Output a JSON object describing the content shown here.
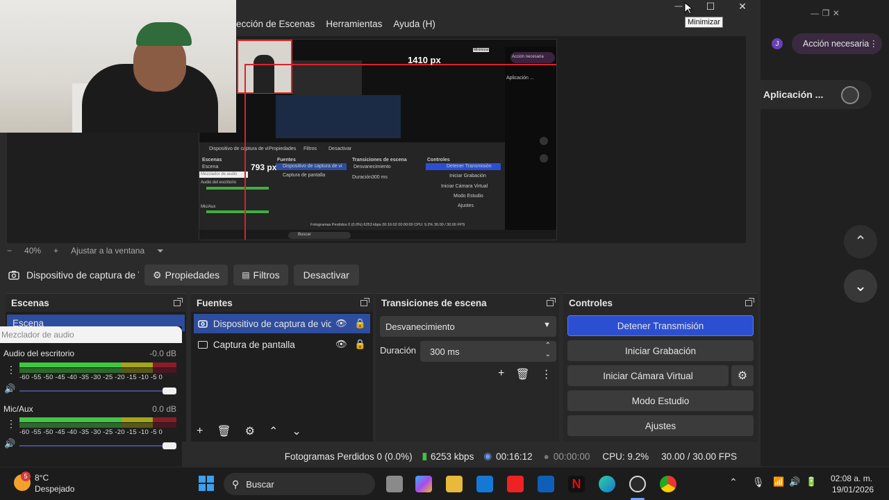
{
  "window": {
    "controls": {
      "minimize": "—",
      "maximize": "☐",
      "close": "✕"
    },
    "tooltip": "Minimizar"
  },
  "menu": {
    "items": [
      "ección de Escenas",
      "Herramientas",
      "Ayuda (H)"
    ]
  },
  "preview": {
    "measure_h": "1410 px",
    "measure_v": "793 px",
    "nested_labels": {
      "source": "Dispositivo de captura de vi",
      "props": "Propiedades",
      "filters": "Filtros",
      "deactivate": "Desactivar",
      "scenes": "Escenas",
      "sources": "Fuentes",
      "transitions": "Transiciones de escena",
      "controls": "Controles",
      "stop": "Detener Transmisión",
      "rec": "Iniciar Grabación",
      "vcam": "Iniciar Cámara Virtual",
      "studio": "Modo Estudio",
      "settings": "Ajustes",
      "fade": "Desvanecimiento",
      "duration": "Duración",
      "ms": "300 ms",
      "capture": "Captura de pantalla",
      "scene": "Escena",
      "mixer": "Mezclador de audio",
      "desk": "Audio del escritorio",
      "mic": "Mic/Aux",
      "search": "Buscar",
      "status": "Fotogramas Perdidos 0 (0.0%)   6253 kbps   00:16:02   00:00:00   CPU: 9.2%   30.00 / 30.00 FPS",
      "app": "Aplicación ...",
      "accion": "Acción necesaria",
      "minimizar": "Minimizar"
    }
  },
  "zoom": {
    "minus": "−",
    "value": "40%",
    "plus": "+",
    "fit": "Ajustar a la ventana",
    "arrow": "⏷"
  },
  "source_bar": {
    "name": "Dispositivo de captura de \\",
    "properties": "Propiedades",
    "filters": "Filtros",
    "deactivate": "Desactivar"
  },
  "scenes": {
    "title": "Escenas",
    "items": [
      "Escena"
    ]
  },
  "sources": {
    "title": "Fuentes",
    "items": [
      {
        "name": "Dispositivo de captura de vid",
        "selected": true
      },
      {
        "name": "Captura de pantalla",
        "selected": false
      }
    ]
  },
  "transitions": {
    "title": "Transiciones de escena",
    "type": "Desvanecimiento",
    "duration_label": "Duración",
    "duration_value": "300 ms"
  },
  "controls": {
    "title": "Controles",
    "stop_stream": "Detener Transmisión",
    "start_recording": "Iniciar Grabación",
    "start_virtual_cam": "Iniciar Cámara Virtual",
    "studio_mode": "Modo Estudio",
    "settings": "Ajustes"
  },
  "mixer": {
    "title": "Mezclador de audio",
    "ticks": "-60 -55 -50 -45 -40 -35 -30 -25 -20 -15 -10  -5   0",
    "channels": [
      {
        "name": "Audio del escritorio",
        "db": "-0.0 dB"
      },
      {
        "name": "Mic/Aux",
        "db": "0.0 dB"
      }
    ]
  },
  "status": {
    "dropped": "Fotogramas Perdidos 0 (0.0%)",
    "bitrate": "6253 kbps",
    "stream_time": "00:16:12",
    "rec_time": "00:00:00",
    "cpu": "CPU: 9.2%",
    "fps": "30.00 / 30.00 FPS"
  },
  "right_panel": {
    "avatar": "J",
    "action": "Acción necesaria",
    "app": "Aplicación ..."
  },
  "taskbar": {
    "weather_temp": "8°C",
    "weather_desc": "Despejado",
    "weather_badge": "5",
    "search": "Buscar",
    "time": "02:08 a. m.",
    "date": "19/01/2026"
  },
  "colors": {
    "accent": "#2f4d9e",
    "stop_button": "#2c4fd1",
    "measure_line": "#e0202a"
  }
}
